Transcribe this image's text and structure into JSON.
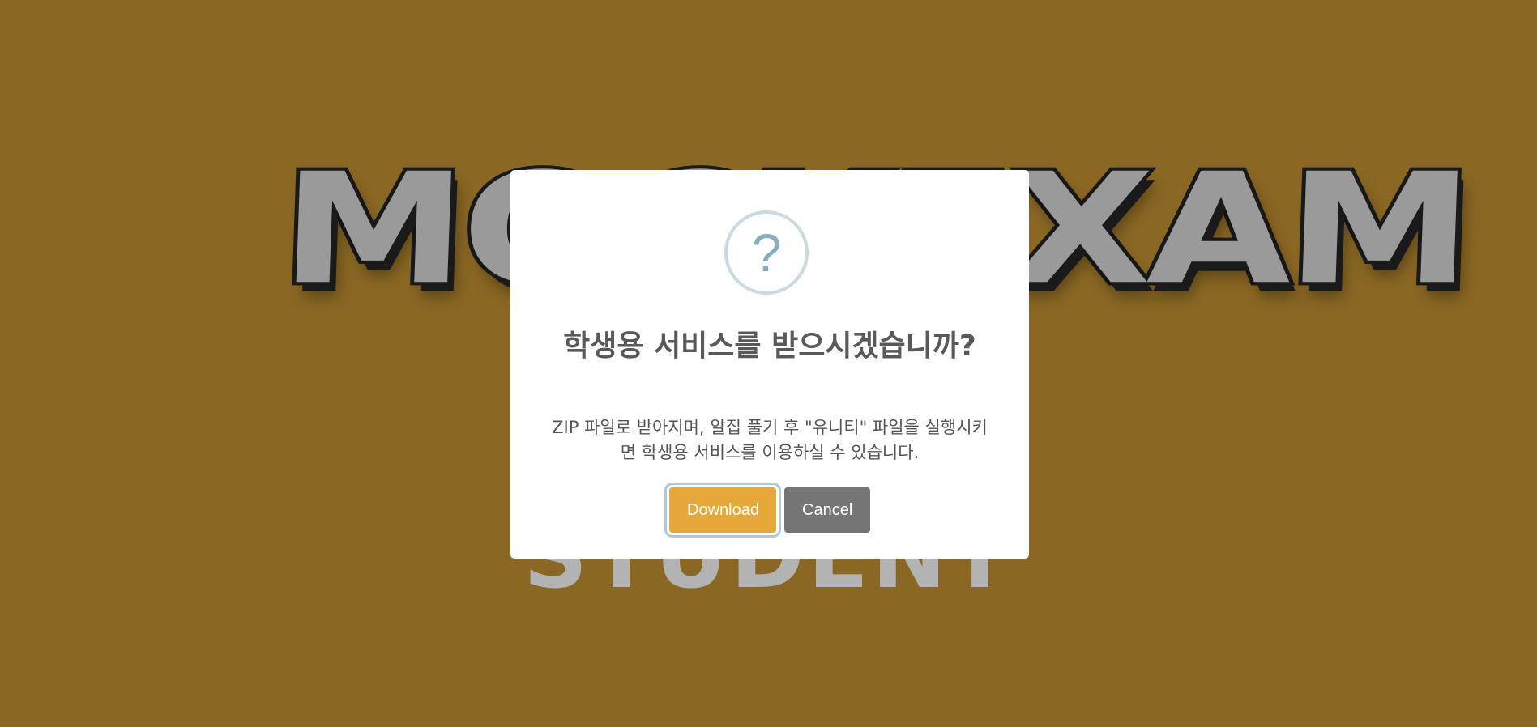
{
  "background": {
    "logo_text": "MOCKEXAM",
    "logo_subtitle": "STUDENT"
  },
  "colors": {
    "page_background": "#8a6723",
    "confirm_button": "#e6a83a",
    "cancel_button": "#757575",
    "icon": "#87adbd"
  },
  "dialog": {
    "icon": "question-icon",
    "icon_glyph": "?",
    "title": "학생용 서비스를 받으시겠습니까?",
    "text": "ZIP 파일로 받아지며, 알집 풀기 후 \"유니티\" 파일을 실행시키면 학생용 서비스를 이용하실 수 있습니다.",
    "confirm_label": "Download",
    "cancel_label": "Cancel"
  }
}
